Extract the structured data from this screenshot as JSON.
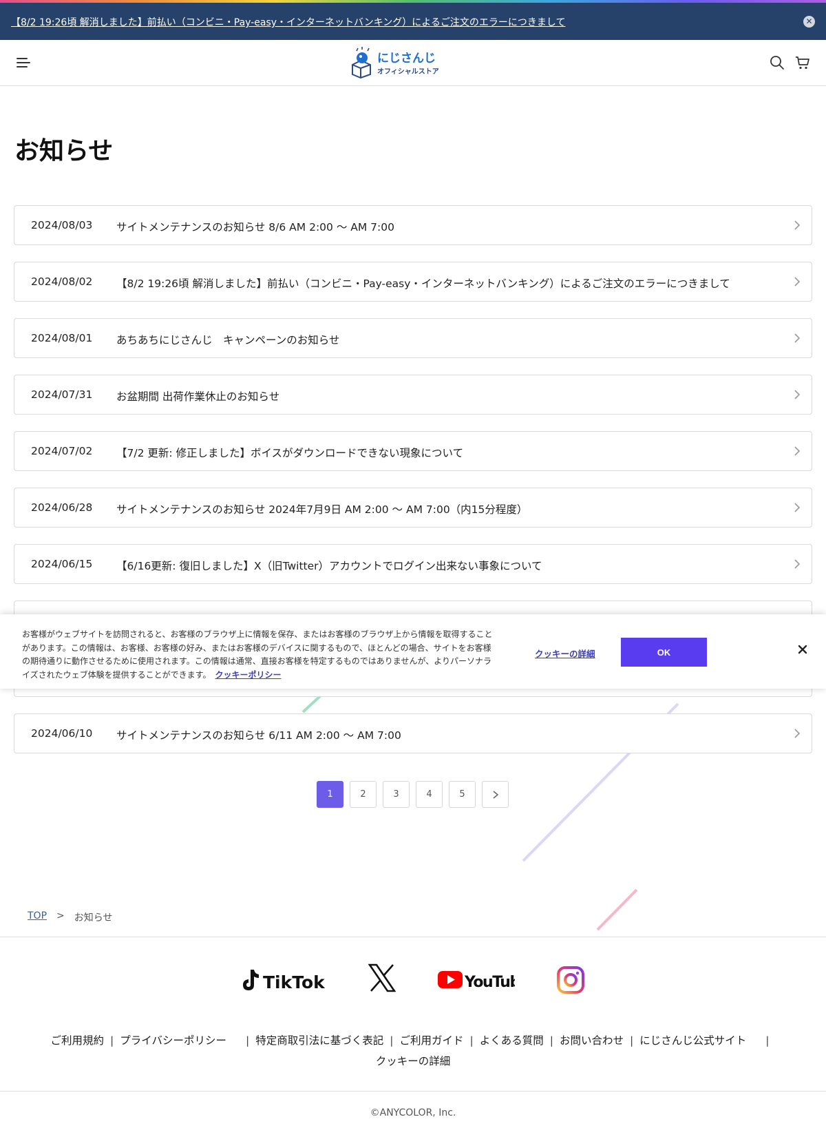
{
  "banner": {
    "text": "【8/2 19:26頃 解消しました】前払い（コンビニ・Pay-easy・インターネットバンキング）によるご注文のエラーにつきまして",
    "close_icon": "close-circle-icon"
  },
  "header": {
    "logo_main": "にじさんじ",
    "logo_sub": "オフィシャルストア",
    "icons": [
      "menu-icon",
      "search-icon",
      "cart-icon"
    ]
  },
  "page": {
    "title": "お知らせ"
  },
  "news": [
    {
      "date": "2024/08/03",
      "title": "サイトメンテナンスのお知らせ 8/6 AM 2:00 〜 AM 7:00"
    },
    {
      "date": "2024/08/02",
      "title": "【8/2 19:26頃 解消しました】前払い（コンビニ・Pay-easy・インターネットバンキング）によるご注文のエラーにつきまして"
    },
    {
      "date": "2024/08/01",
      "title": "あちあちにじさんじ　キャンペーンのお知らせ"
    },
    {
      "date": "2024/07/31",
      "title": "お盆期間 出荷作業休止のお知らせ"
    },
    {
      "date": "2024/07/02",
      "title": "【7/2 更新: 修正しました】ボイスがダウンロードできない現象について"
    },
    {
      "date": "2024/06/28",
      "title": "サイトメンテナンスのお知らせ 2024年7月9日 AM 2:00 〜 AM 7:00（内15分程度）"
    },
    {
      "date": "2024/06/15",
      "title": "【6/16更新: 復旧しました】X（旧Twitter）アカウントでログイン出来ない事象について"
    },
    {
      "date": "",
      "title": ""
    },
    {
      "date": "",
      "title": ""
    },
    {
      "date": "2024/06/10",
      "title": "サイトメンテナンスのお知らせ 6/11 AM 2:00 〜 AM 7:00"
    }
  ],
  "pagination": {
    "pages": [
      "1",
      "2",
      "3",
      "4",
      "5"
    ],
    "current": "1",
    "next_icon": "chevron-right-icon"
  },
  "breadcrumb": {
    "home": "TOP",
    "separator": ">",
    "current": "お知らせ"
  },
  "social": {
    "tiktok": "TikTok",
    "x": "X",
    "youtube": "YouTube",
    "instagram": "Instagram"
  },
  "footer": {
    "links": [
      "ご利用規約",
      "プライバシーポリシー",
      "特定商取引法に基づく表記",
      "ご利用ガイド",
      "よくある質問",
      "お問い合わせ",
      "にじさんじ公式サイト"
    ],
    "cookie_details": "クッキーの詳細",
    "copyright": "©ANYCOLOR, Inc."
  },
  "cookie": {
    "text": "お客様がウェブサイトを訪問されると、お客様のブラウザ上に情報を保存、またはお客様のブラウザ上から情報を取得することがあります。この情報は、お客様、お客様の好み、またはお客様のデバイスに関するもので、ほとんどの場合、サイトをお客様の期待通りに動作させるために使用されます。この情報は通常、直接お客様を特定するものではありませんが、よりパーソナライズされたウェブ体験を提供することができます。",
    "policy_link": "クッキーポリシー",
    "details_link": "クッキーの詳細",
    "ok_label": "OK",
    "close_icon": "close-icon"
  },
  "colors": {
    "banner_bg": "#26426a",
    "accent": "#6c5ce7",
    "cookie_ok": "#5a3cf0",
    "link": "#3d3db8"
  }
}
